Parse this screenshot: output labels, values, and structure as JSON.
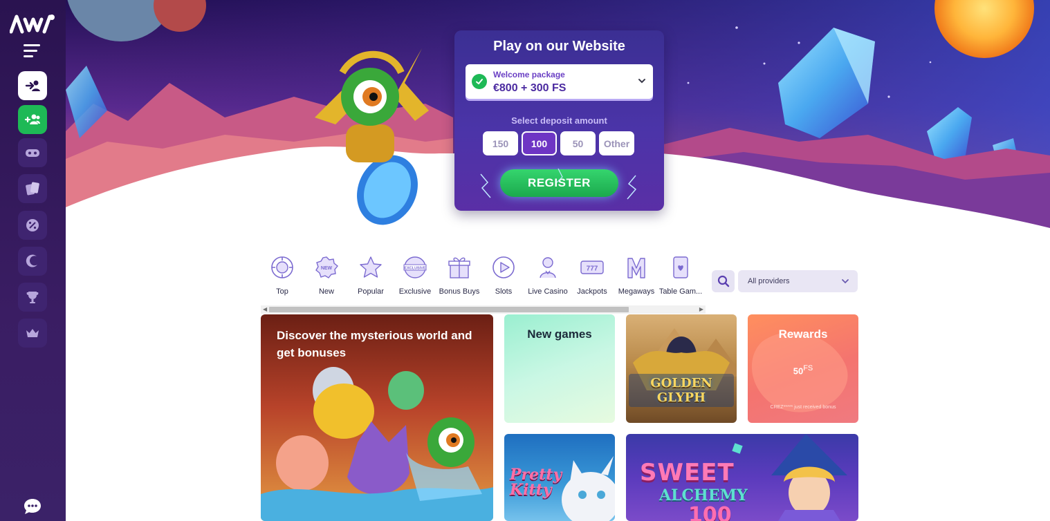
{
  "sidebar": {
    "logo_icon": "casino-logo-icon",
    "menu_icon": "hamburger-menu-icon",
    "buttons": [
      {
        "name": "login-button",
        "icon": "login-arrow-icon",
        "style": "white"
      },
      {
        "name": "signup-button",
        "icon": "add-user-icon",
        "style": "green"
      },
      {
        "name": "games-button",
        "icon": "gamepad-icon",
        "style": "dark"
      },
      {
        "name": "live-casino-button",
        "icon": "cards-icon",
        "style": "dark"
      },
      {
        "name": "promotions-button",
        "icon": "percent-badge-icon",
        "style": "dark"
      },
      {
        "name": "moon-button",
        "icon": "moon-icon",
        "style": "dark"
      },
      {
        "name": "tournaments-button",
        "icon": "trophy-icon",
        "style": "dark"
      },
      {
        "name": "vip-button",
        "icon": "crown-icon",
        "style": "dark"
      }
    ],
    "chat_icon": "chat-bubble-icon"
  },
  "hero": {
    "title": "Play on our Website",
    "package_label": "Welcome package",
    "package_value": "€800 + 300 FS",
    "deposit_label": "Select deposit amount",
    "amounts": [
      "150",
      "100",
      "50",
      "Other"
    ],
    "selected_amount": "100",
    "register_label": "REGISTER"
  },
  "categories": [
    {
      "label": "Top",
      "icon": "chip-icon"
    },
    {
      "label": "New",
      "icon": "new-badge-icon"
    },
    {
      "label": "Popular",
      "icon": "star-icon"
    },
    {
      "label": "Exclusive",
      "icon": "exclusive-badge-icon"
    },
    {
      "label": "Bonus Buys",
      "icon": "gift-icon"
    },
    {
      "label": "Slots",
      "icon": "play-icon"
    },
    {
      "label": "Live Casino",
      "icon": "dealer-icon"
    },
    {
      "label": "Jackpots",
      "icon": "jackpot-777-icon"
    },
    {
      "label": "Megaways",
      "icon": "megaways-icon"
    },
    {
      "label": "Table Gam...",
      "icon": "table-card-icon"
    }
  ],
  "filters": {
    "search_icon": "search-icon",
    "provider_value": "All providers",
    "provider_chevron": "chevron-down-icon"
  },
  "tiles": {
    "discover_title": "Discover the mysterious world and get bonuses",
    "new_games_title": "New games",
    "golden_glyph_logo": "GOLDEN GLYPH",
    "rewards_title": "Rewards",
    "rewards_amount": "50",
    "rewards_unit": "FS",
    "rewards_note": "CREZ***** just received bonus",
    "pretty_kitty_logo_1": "Pretty",
    "pretty_kitty_logo_2": "Kitty",
    "sweet_alchemy_logo_1": "SWEET",
    "sweet_alchemy_logo_2": "ALCHEMY",
    "sweet_alchemy_logo_3": "100"
  },
  "colors": {
    "sidebar_bg": "#2a1350",
    "accent_green": "#1eb956",
    "accent_purple": "#6e35c4",
    "panel_blue": "#3b2f93"
  }
}
